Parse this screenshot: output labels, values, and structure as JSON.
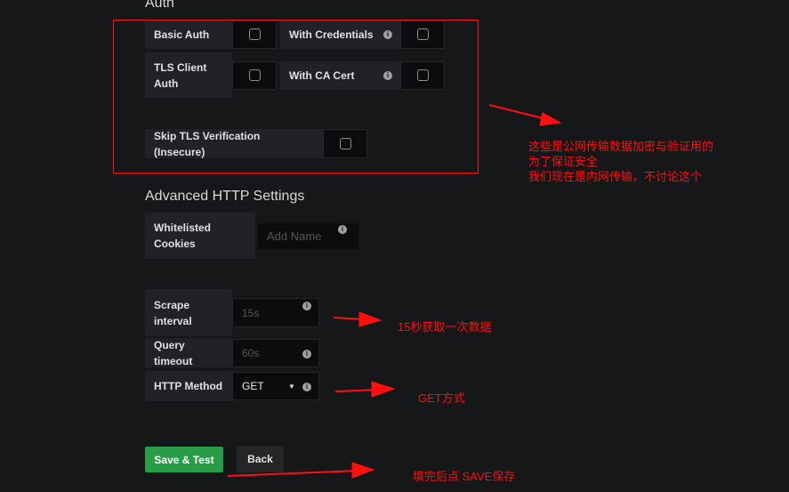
{
  "auth": {
    "title": "Auth",
    "basic_auth": "Basic Auth",
    "with_credentials": "With Credentials",
    "tls_client_auth": "TLS Client Auth",
    "with_ca_cert": "With CA Cert",
    "skip_tls": "Skip TLS Verification (Insecure)"
  },
  "advanced": {
    "title": "Advanced HTTP Settings",
    "whitelisted_cookies": "Whitelisted Cookies",
    "cookies_placeholder": "Add Name",
    "scrape_interval": "Scrape interval",
    "scrape_placeholder": "15s",
    "query_timeout": "Query timeout",
    "query_placeholder": "60s",
    "http_method": "HTTP Method",
    "http_method_value": "GET"
  },
  "buttons": {
    "save_test": "Save & Test",
    "back": "Back"
  },
  "annotations": {
    "auth_note_line1": "这些是公网传输数据加密与验证用的",
    "auth_note_line2": "为了保证安全",
    "auth_note_line3": "我们现在是内网传输，不讨论这个",
    "scrape_note": "15秒获取一次数据",
    "method_note": "GET方式",
    "save_note": "填完后点 SAVE保存",
    "color": "#ff1010"
  },
  "colors": {
    "background": "#161719",
    "save_button": "#299c46",
    "label_bg": "#202226"
  }
}
